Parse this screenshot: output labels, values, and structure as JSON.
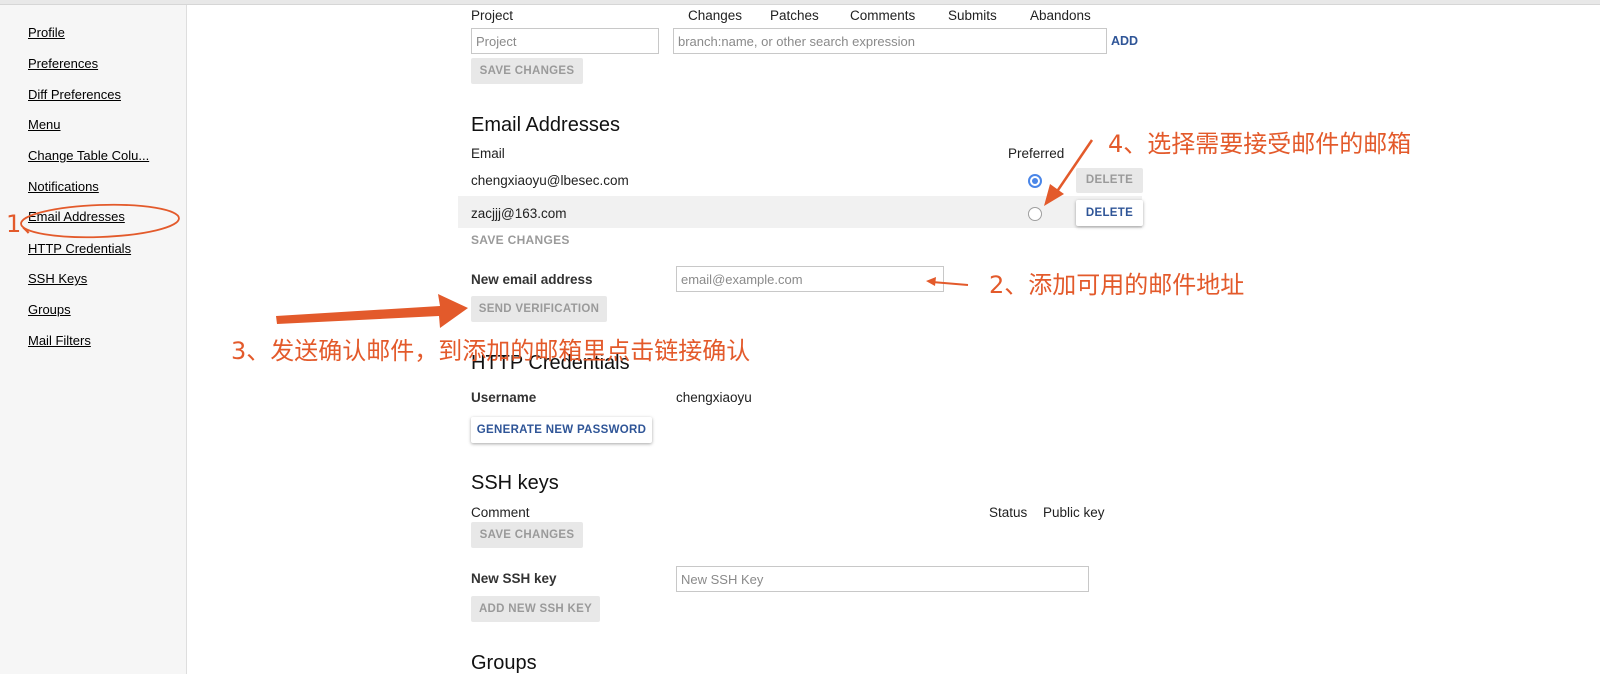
{
  "sidebar": {
    "items": [
      {
        "label": "Profile"
      },
      {
        "label": "Preferences"
      },
      {
        "label": "Diff Preferences"
      },
      {
        "label": "Menu"
      },
      {
        "label": "Change Table Colu..."
      },
      {
        "label": "Notifications"
      },
      {
        "label": "Email Addresses"
      },
      {
        "label": "HTTP Credentials"
      },
      {
        "label": "SSH Keys"
      },
      {
        "label": "Groups"
      },
      {
        "label": "Mail Filters"
      }
    ]
  },
  "watched_projects": {
    "columns": [
      "Project",
      "Changes",
      "Patches",
      "Comments",
      "Submits",
      "Abandons"
    ],
    "project_placeholder": "Project",
    "filter_placeholder": "branch:name, or other search expression",
    "add_label": "ADD",
    "save_label": "SAVE CHANGES"
  },
  "emails": {
    "title": "Email Addresses",
    "email_header": "Email",
    "preferred_header": "Preferred",
    "rows": [
      {
        "email": "chengxiaoyu@lbesec.com",
        "preferred": true,
        "delete_label": "DELETE"
      },
      {
        "email": "zacjjj@163.com",
        "preferred": false,
        "delete_label": "DELETE"
      }
    ],
    "save_label": "SAVE CHANGES",
    "new_label": "New email address",
    "new_placeholder": "email@example.com",
    "send_label": "SEND VERIFICATION"
  },
  "http": {
    "title": "HTTP Credentials",
    "username_label": "Username",
    "username_value": "chengxiaoyu",
    "generate_label": "GENERATE NEW PASSWORD"
  },
  "ssh": {
    "title": "SSH keys",
    "comment_header": "Comment",
    "status_header": "Status",
    "public_key_header": "Public key",
    "save_label": "SAVE CHANGES",
    "new_label": "New SSH key",
    "new_placeholder": "New SSH Key",
    "add_label": "ADD NEW SSH KEY"
  },
  "groups": {
    "title": "Groups"
  },
  "annotations": {
    "step1": "1、",
    "step2": "2、添加可用的邮件地址",
    "step3": "3、发送确认邮件，到添加的邮箱里点击链接确认",
    "step4": "4、选择需要接受邮件的邮箱",
    "color": "#e35a2b"
  }
}
